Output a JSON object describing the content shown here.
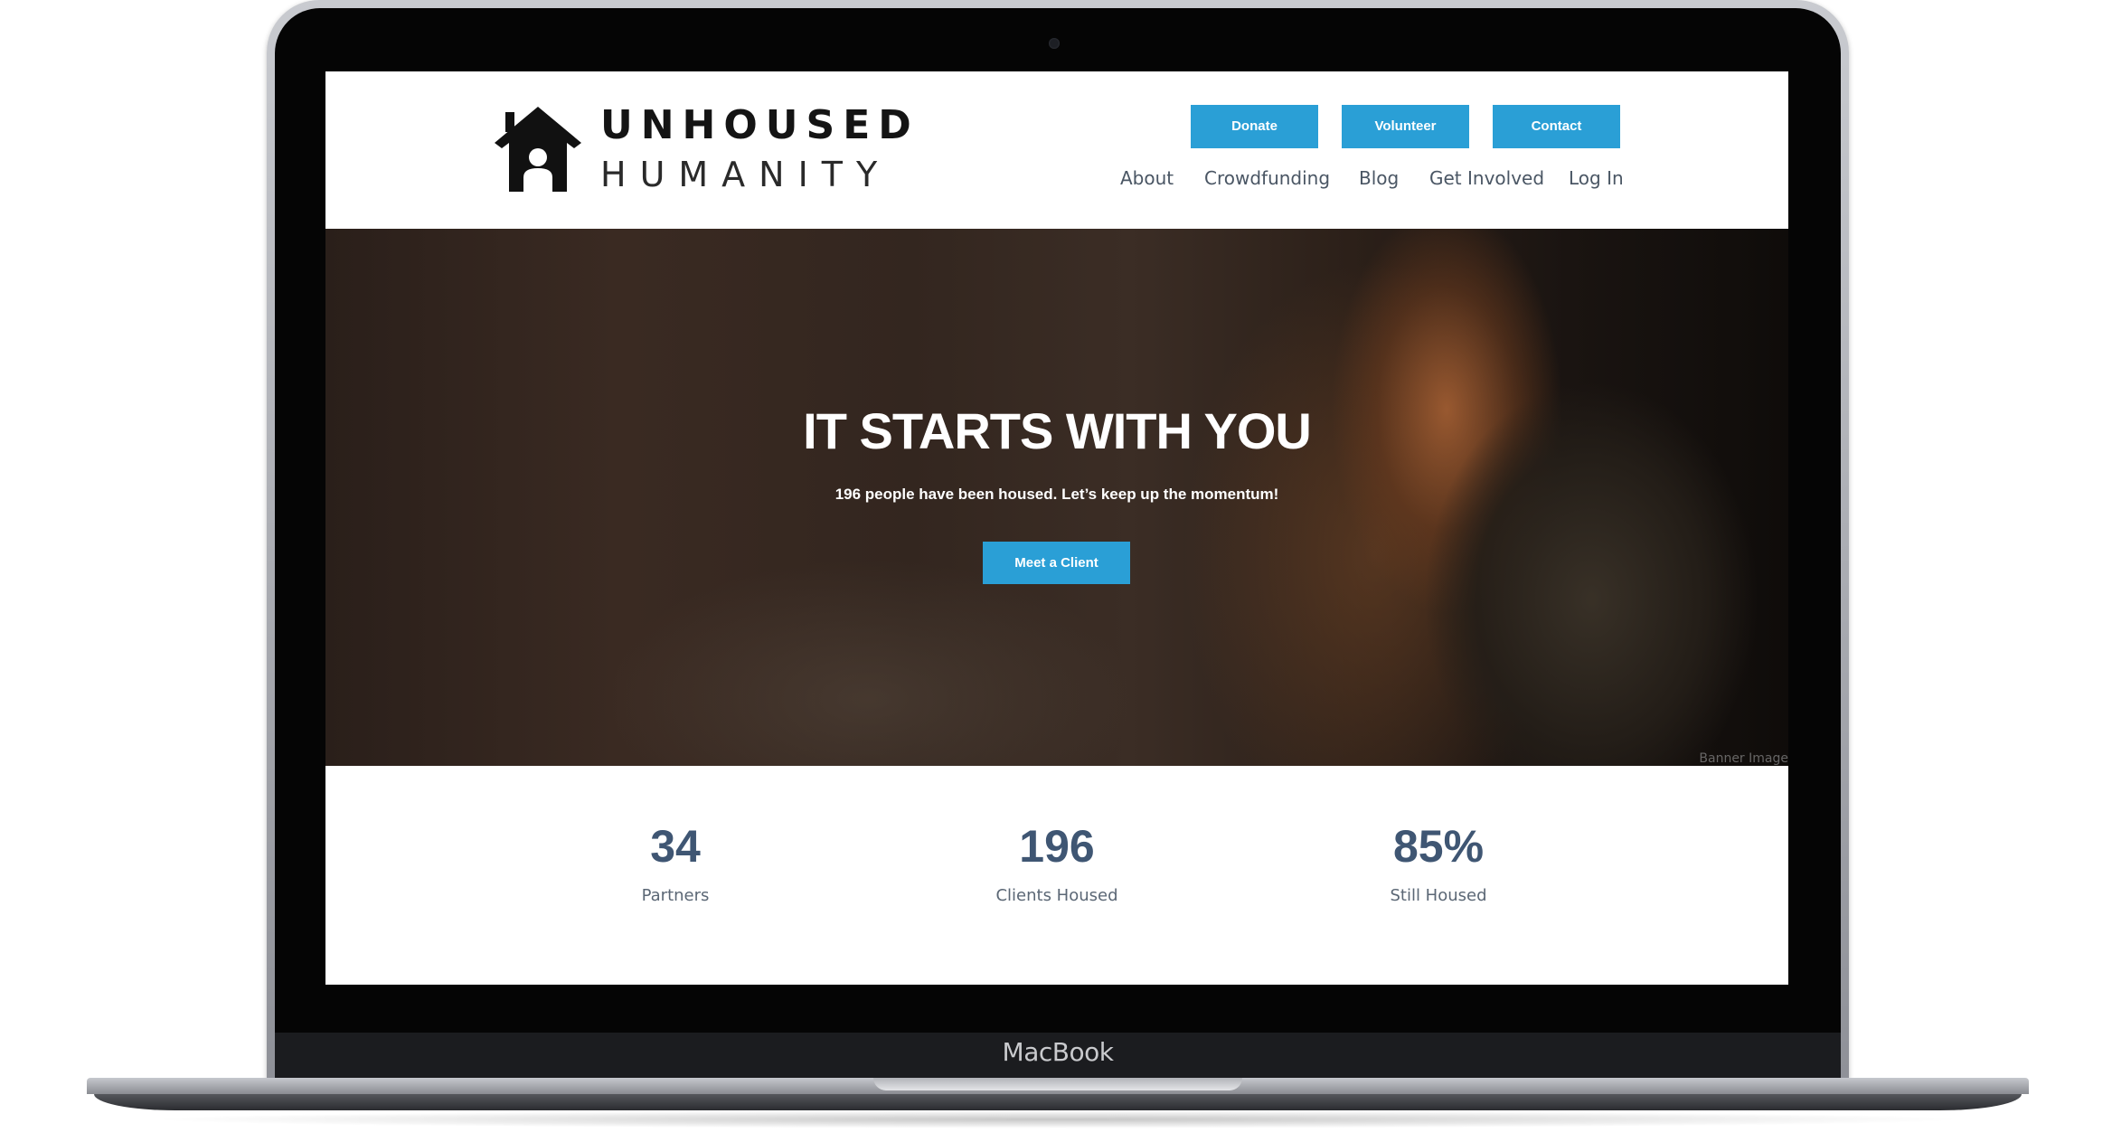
{
  "device": {
    "brand_label": "MacBook"
  },
  "site": {
    "logo": {
      "line1": "UNHOUSED",
      "line2": "HUMANITY",
      "icon": "house-person-icon"
    },
    "cta_buttons": [
      {
        "label": "Donate"
      },
      {
        "label": "Volunteer"
      },
      {
        "label": "Contact"
      }
    ],
    "nav": [
      {
        "label": "About"
      },
      {
        "label": "Crowdfunding"
      },
      {
        "label": "Blog"
      },
      {
        "label": "Get Involved"
      },
      {
        "label": "Log In"
      }
    ],
    "hero": {
      "title": "IT STARTS WITH YOU",
      "subtitle": "196 people have been housed. Let’s keep up the momentum!",
      "button_label": "Meet a Client",
      "image_credit": "Banner Image"
    },
    "stats": [
      {
        "value": "34",
        "label": "Partners"
      },
      {
        "value": "196",
        "label": "Clients Housed"
      },
      {
        "value": "85%",
        "label": "Still Housed"
      }
    ],
    "colors": {
      "accent": "#2a9fd6",
      "stat_text": "#3f5673",
      "nav_text": "#4a5664"
    }
  }
}
